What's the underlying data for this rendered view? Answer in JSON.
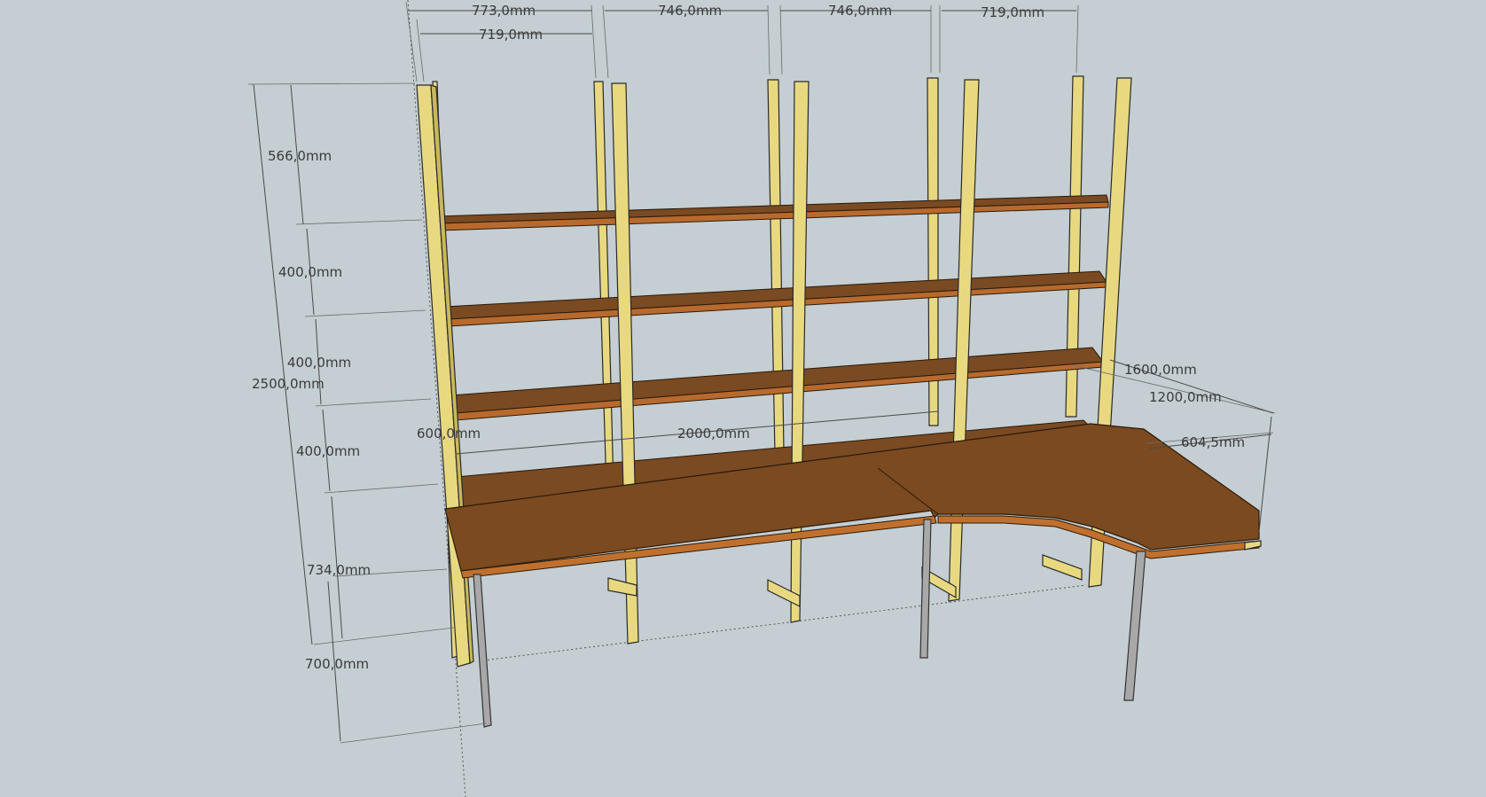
{
  "scene": {
    "background": "#c4ced3",
    "wood_color": "#7b4a20",
    "post_color": "#e8d980",
    "leg_color": "#a8a8a8"
  },
  "dimensions": {
    "top_width_total": "773,0mm",
    "top_width_inner": "719,0mm",
    "bay_2": "746,0mm",
    "bay_3": "746,0mm",
    "bay_4": "719,0mm",
    "top_gap": "566,0mm",
    "shelf_gap_1": "400,0mm",
    "shelf_gap_2": "400,0mm",
    "shelf_gap_3": "400,0mm",
    "total_height": "2500,0mm",
    "desk_height": "734,0mm",
    "leg_height": "700,0mm",
    "depth": "600,0mm",
    "desk_length": "2000,0mm",
    "return_length_outer": "1600,0mm",
    "return_length_inner": "1200,0mm",
    "return_width": "604,5mm"
  }
}
